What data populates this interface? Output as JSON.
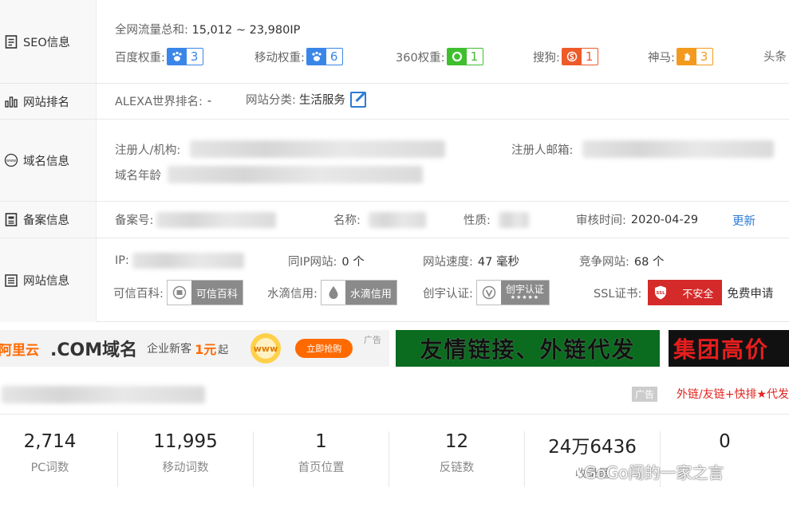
{
  "seo": {
    "label": "SEO信息",
    "traffic_label": "全网流量总和:",
    "traffic_value": "15,012 ~ 23,980IP",
    "weights": [
      {
        "label": "百度权重:",
        "value": "3",
        "color": "#3a86e8"
      },
      {
        "label": "移动权重:",
        "value": "6",
        "color": "#3a86e8"
      },
      {
        "label": "360权重:",
        "value": "1",
        "color": "#3fbf2f"
      },
      {
        "label": "搜狗:",
        "value": "1",
        "color": "#ee5a2a"
      },
      {
        "label": "神马:",
        "value": "3",
        "color": "#f39a1e"
      },
      {
        "label": "头条",
        "value": "",
        "color": "#999999"
      }
    ]
  },
  "rank": {
    "label": "网站排名",
    "alexa_label": "ALEXA世界排名:",
    "alexa_value": "-",
    "category_label": "网站分类:",
    "category_value": "生活服务"
  },
  "domain": {
    "label": "域名信息",
    "registrant_label": "注册人/机构:",
    "email_label": "注册人邮箱:",
    "age_label": "域名年龄"
  },
  "icp": {
    "label": "备案信息",
    "number_label": "备案号:",
    "name_label": "名称:",
    "nature_label": "性质:",
    "audit_label": "审核时间:",
    "audit_value": "2020-04-29",
    "update_link": "更新"
  },
  "site": {
    "label": "网站信息",
    "ip_label": "IP:",
    "same_ip_label": "同IP网站:",
    "same_ip_value": "0 个",
    "speed_label": "网站速度:",
    "speed_value": "47 毫秒",
    "compete_label": "竞争网站:",
    "compete_value": "68 个",
    "kexin_label": "可信百科:",
    "kexin_badge": "可信百科",
    "shuidi_label": "水滴信用:",
    "shuidi_badge": "水滴信用",
    "chuangyu_label": "创宇认证:",
    "chuangyu_badge": "创宇认证",
    "chuangyu_stars": "★★★★★",
    "ssl_label": "SSL证书:",
    "ssl_badge": "不安全",
    "ssl_icon_text": "SSL",
    "ssl_apply": "免费申请"
  },
  "ads": {
    "ad1_brand": "阿里云",
    "ad1_main": ".COM域名",
    "ad1_sub": "企业新客",
    "ad1_price": "1元",
    "ad1_suffix": "起",
    "ad1_cta": "立即抢购",
    "ad1_tag": "广告",
    "ad2_text": "友情链接、外链代发",
    "ad3_text": "集团高价",
    "colors": {
      "ad2_bg": "#0b6b1f",
      "ad3_text": "#e61e1e"
    }
  },
  "section2": {
    "ad_tag": "广告",
    "promo_text": "外链/友链+快排★代发"
  },
  "stats": [
    {
      "num": "2,714",
      "label": "PC词数"
    },
    {
      "num": "11,995",
      "label": "移动词数"
    },
    {
      "num": "1",
      "label": "首页位置"
    },
    {
      "num": "12",
      "label": "反链数"
    },
    {
      "num": "24万6436",
      "label": "收录量"
    },
    {
      "num": "0",
      "label": ""
    }
  ],
  "watermark": {
    "text": "GoGo闯的一家之言"
  }
}
